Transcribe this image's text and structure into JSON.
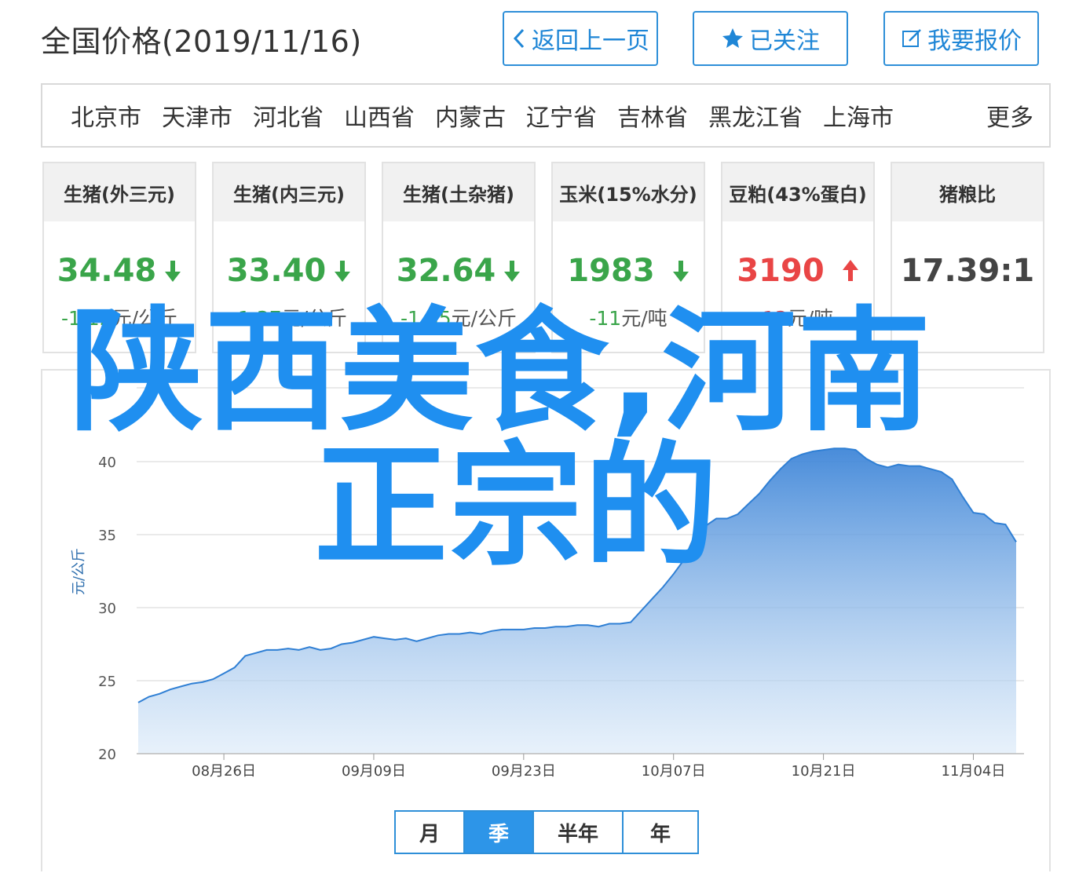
{
  "header": {
    "title": "全国价格(2019/11/16)"
  },
  "buttons": {
    "back": "返回上一页",
    "follow": "已关注",
    "quote": "我要报价"
  },
  "provinces": [
    "北京市",
    "天津市",
    "河北省",
    "山西省",
    "内蒙古",
    "辽宁省",
    "吉林省",
    "黑龙江省",
    "上海市"
  ],
  "provinces_more": "更多",
  "cards": [
    {
      "title": "生猪(外三元)",
      "value": "34.48",
      "change_num": "-1.12",
      "change_unit": "元/公斤",
      "trend": "down"
    },
    {
      "title": "生猪(内三元)",
      "value": "33.40",
      "change_num": "-1.37",
      "change_unit": "元/公斤",
      "trend": "down"
    },
    {
      "title": "生猪(土杂猪)",
      "value": "32.64",
      "change_num": "-1.35",
      "change_unit": "元/公斤",
      "trend": "down"
    },
    {
      "title": "玉米(15%水分)",
      "value": "1983",
      "change_num": "-11",
      "change_unit": "元/吨",
      "trend": "down"
    },
    {
      "title": "豆粕(43%蛋白)",
      "value": "3190",
      "change_num": "13",
      "change_unit": "元/吨",
      "trend": "up"
    },
    {
      "title": "猪粮比",
      "value": "17.39:1",
      "change_num": "",
      "change_unit": "",
      "trend": "none"
    }
  ],
  "colors": {
    "accent": "#2e8fd8",
    "down": "#3aa54a",
    "up": "#e94545",
    "line": "#2f7fd4"
  },
  "chart_data": {
    "type": "area",
    "title": "",
    "xlabel": "",
    "ylabel": "元/公斤",
    "ylim": [
      20,
      45
    ],
    "yticks": [
      20,
      25,
      30,
      35,
      40
    ],
    "grid": true,
    "x_labels": [
      "08月26日",
      "09月09日",
      "09月23日",
      "10月07日",
      "10月21日",
      "11月04日"
    ],
    "x_label_index": [
      8,
      22,
      36,
      50,
      64,
      78
    ],
    "values": [
      23.5,
      23.9,
      24.1,
      24.4,
      24.6,
      24.8,
      24.9,
      25.1,
      25.5,
      25.9,
      26.7,
      26.9,
      27.1,
      27.1,
      27.2,
      27.1,
      27.3,
      27.1,
      27.2,
      27.5,
      27.6,
      27.8,
      28.0,
      27.9,
      27.8,
      27.9,
      27.7,
      27.9,
      28.1,
      28.2,
      28.2,
      28.3,
      28.2,
      28.4,
      28.5,
      28.5,
      28.5,
      28.6,
      28.6,
      28.7,
      28.7,
      28.8,
      28.8,
      28.7,
      28.9,
      28.9,
      29.0,
      29.8,
      30.6,
      31.4,
      32.3,
      33.3,
      35.0,
      35.6,
      36.1,
      36.1,
      36.4,
      37.1,
      37.8,
      38.7,
      39.5,
      40.2,
      40.5,
      40.7,
      40.8,
      40.9,
      40.9,
      40.8,
      40.2,
      39.8,
      39.6,
      39.8,
      39.7,
      39.7,
      39.5,
      39.3,
      38.8,
      37.6,
      36.5,
      36.4,
      35.8,
      35.7,
      34.5
    ]
  },
  "ranges": [
    "月",
    "季",
    "半年",
    "年"
  ],
  "active_range": "季",
  "watermark": {
    "line1": "陕西美食,河南",
    "line2": "正宗的"
  }
}
